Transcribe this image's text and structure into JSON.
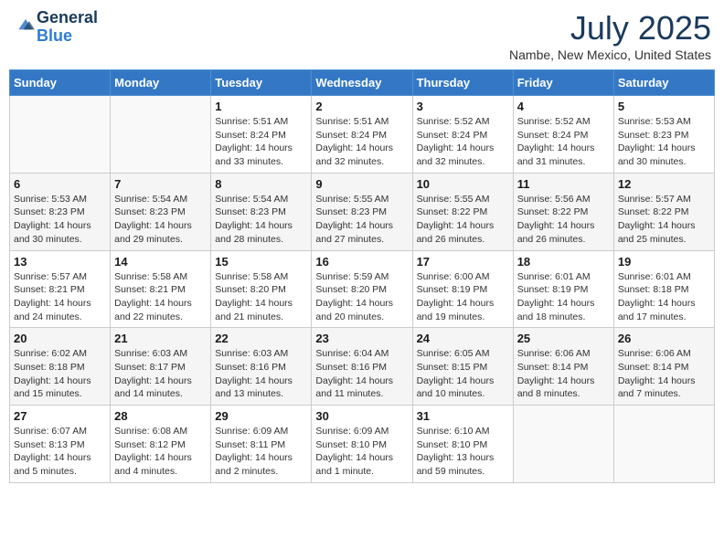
{
  "header": {
    "logo_general": "General",
    "logo_blue": "Blue",
    "month_title": "July 2025",
    "location": "Nambe, New Mexico, United States"
  },
  "days_of_week": [
    "Sunday",
    "Monday",
    "Tuesday",
    "Wednesday",
    "Thursday",
    "Friday",
    "Saturday"
  ],
  "weeks": [
    [
      {
        "day": "",
        "info": ""
      },
      {
        "day": "",
        "info": ""
      },
      {
        "day": "1",
        "info": "Sunrise: 5:51 AM\nSunset: 8:24 PM\nDaylight: 14 hours and 33 minutes."
      },
      {
        "day": "2",
        "info": "Sunrise: 5:51 AM\nSunset: 8:24 PM\nDaylight: 14 hours and 32 minutes."
      },
      {
        "day": "3",
        "info": "Sunrise: 5:52 AM\nSunset: 8:24 PM\nDaylight: 14 hours and 32 minutes."
      },
      {
        "day": "4",
        "info": "Sunrise: 5:52 AM\nSunset: 8:24 PM\nDaylight: 14 hours and 31 minutes."
      },
      {
        "day": "5",
        "info": "Sunrise: 5:53 AM\nSunset: 8:23 PM\nDaylight: 14 hours and 30 minutes."
      }
    ],
    [
      {
        "day": "6",
        "info": "Sunrise: 5:53 AM\nSunset: 8:23 PM\nDaylight: 14 hours and 30 minutes."
      },
      {
        "day": "7",
        "info": "Sunrise: 5:54 AM\nSunset: 8:23 PM\nDaylight: 14 hours and 29 minutes."
      },
      {
        "day": "8",
        "info": "Sunrise: 5:54 AM\nSunset: 8:23 PM\nDaylight: 14 hours and 28 minutes."
      },
      {
        "day": "9",
        "info": "Sunrise: 5:55 AM\nSunset: 8:23 PM\nDaylight: 14 hours and 27 minutes."
      },
      {
        "day": "10",
        "info": "Sunrise: 5:55 AM\nSunset: 8:22 PM\nDaylight: 14 hours and 26 minutes."
      },
      {
        "day": "11",
        "info": "Sunrise: 5:56 AM\nSunset: 8:22 PM\nDaylight: 14 hours and 26 minutes."
      },
      {
        "day": "12",
        "info": "Sunrise: 5:57 AM\nSunset: 8:22 PM\nDaylight: 14 hours and 25 minutes."
      }
    ],
    [
      {
        "day": "13",
        "info": "Sunrise: 5:57 AM\nSunset: 8:21 PM\nDaylight: 14 hours and 24 minutes."
      },
      {
        "day": "14",
        "info": "Sunrise: 5:58 AM\nSunset: 8:21 PM\nDaylight: 14 hours and 22 minutes."
      },
      {
        "day": "15",
        "info": "Sunrise: 5:58 AM\nSunset: 8:20 PM\nDaylight: 14 hours and 21 minutes."
      },
      {
        "day": "16",
        "info": "Sunrise: 5:59 AM\nSunset: 8:20 PM\nDaylight: 14 hours and 20 minutes."
      },
      {
        "day": "17",
        "info": "Sunrise: 6:00 AM\nSunset: 8:19 PM\nDaylight: 14 hours and 19 minutes."
      },
      {
        "day": "18",
        "info": "Sunrise: 6:01 AM\nSunset: 8:19 PM\nDaylight: 14 hours and 18 minutes."
      },
      {
        "day": "19",
        "info": "Sunrise: 6:01 AM\nSunset: 8:18 PM\nDaylight: 14 hours and 17 minutes."
      }
    ],
    [
      {
        "day": "20",
        "info": "Sunrise: 6:02 AM\nSunset: 8:18 PM\nDaylight: 14 hours and 15 minutes."
      },
      {
        "day": "21",
        "info": "Sunrise: 6:03 AM\nSunset: 8:17 PM\nDaylight: 14 hours and 14 minutes."
      },
      {
        "day": "22",
        "info": "Sunrise: 6:03 AM\nSunset: 8:16 PM\nDaylight: 14 hours and 13 minutes."
      },
      {
        "day": "23",
        "info": "Sunrise: 6:04 AM\nSunset: 8:16 PM\nDaylight: 14 hours and 11 minutes."
      },
      {
        "day": "24",
        "info": "Sunrise: 6:05 AM\nSunset: 8:15 PM\nDaylight: 14 hours and 10 minutes."
      },
      {
        "day": "25",
        "info": "Sunrise: 6:06 AM\nSunset: 8:14 PM\nDaylight: 14 hours and 8 minutes."
      },
      {
        "day": "26",
        "info": "Sunrise: 6:06 AM\nSunset: 8:14 PM\nDaylight: 14 hours and 7 minutes."
      }
    ],
    [
      {
        "day": "27",
        "info": "Sunrise: 6:07 AM\nSunset: 8:13 PM\nDaylight: 14 hours and 5 minutes."
      },
      {
        "day": "28",
        "info": "Sunrise: 6:08 AM\nSunset: 8:12 PM\nDaylight: 14 hours and 4 minutes."
      },
      {
        "day": "29",
        "info": "Sunrise: 6:09 AM\nSunset: 8:11 PM\nDaylight: 14 hours and 2 minutes."
      },
      {
        "day": "30",
        "info": "Sunrise: 6:09 AM\nSunset: 8:10 PM\nDaylight: 14 hours and 1 minute."
      },
      {
        "day": "31",
        "info": "Sunrise: 6:10 AM\nSunset: 8:10 PM\nDaylight: 13 hours and 59 minutes."
      },
      {
        "day": "",
        "info": ""
      },
      {
        "day": "",
        "info": ""
      }
    ]
  ]
}
